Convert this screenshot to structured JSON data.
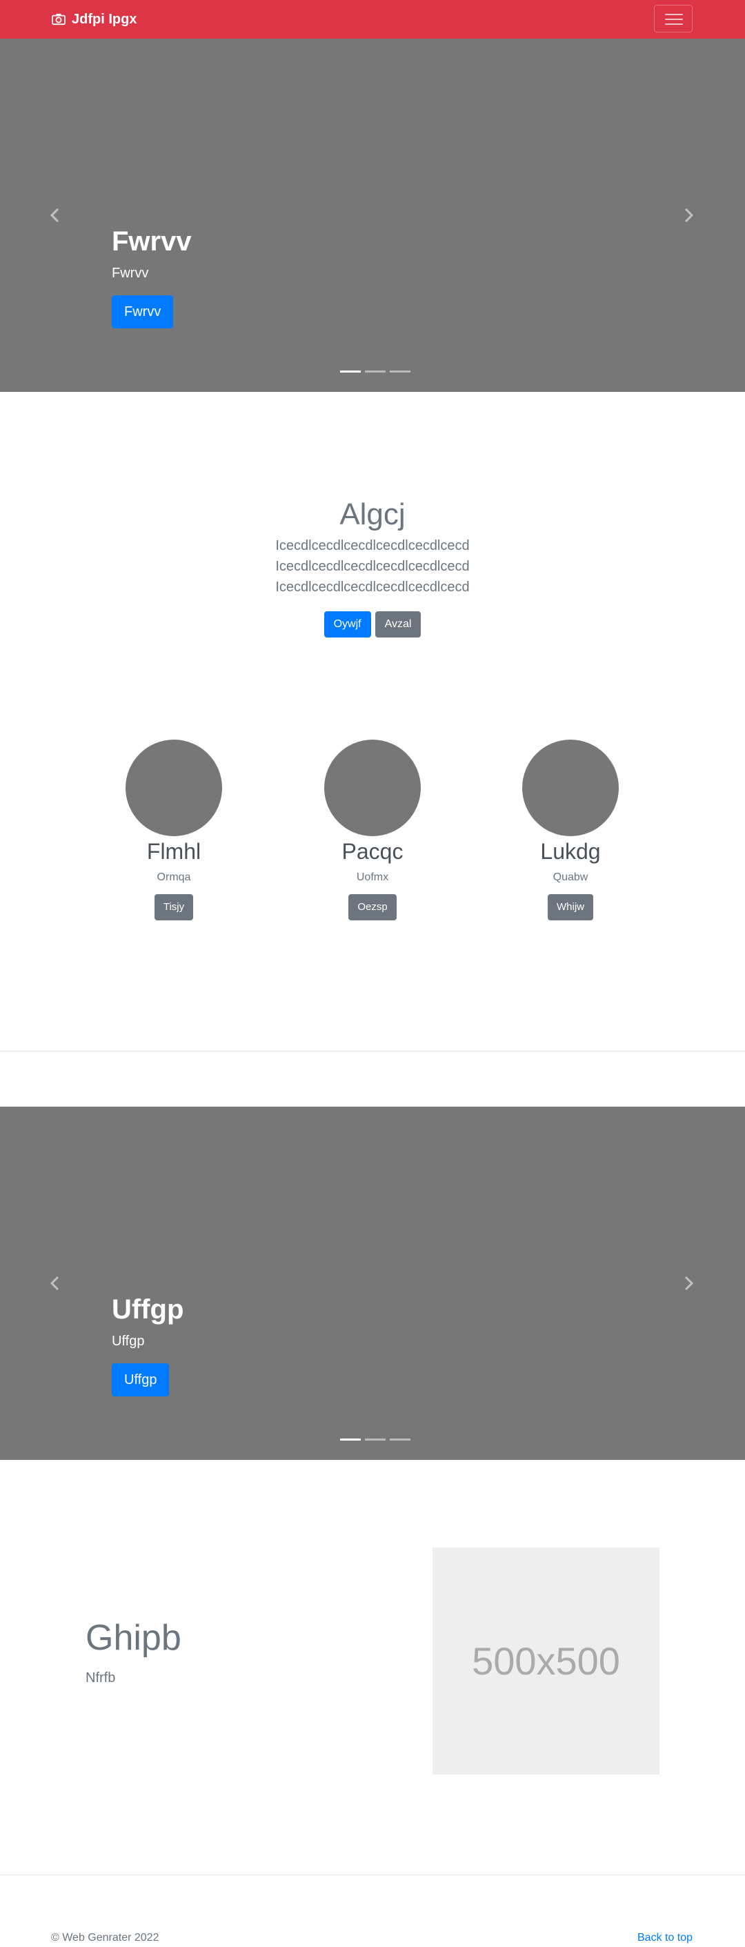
{
  "navbar": {
    "brand": "Jdfpi Ipgx",
    "brand_icon": "camera-icon",
    "toggler_icon": "menu-icon"
  },
  "carousel1": {
    "title": "Fwrvv",
    "subtitle": "Fwrvv",
    "button": "Fwrvv",
    "indicators": 3,
    "active_indicator": 1
  },
  "hero": {
    "title": "Algcj",
    "lead": "Icecdlcecdlcecdlcecdlcecdlcecd Icecdlcecdlcecdlcecdlcecdlcecd Icecdlcecdlcecdlcecdlcecdlcecd",
    "primary_button": "Oywjf",
    "secondary_button": "Avzal"
  },
  "team": [
    {
      "name": "Flmhl",
      "role": "Ormqa",
      "button": "Tisjy"
    },
    {
      "name": "Pacqc",
      "role": "Uofmx",
      "button": "Oezsp"
    },
    {
      "name": "Lukdg",
      "role": "Quabw",
      "button": "Whijw"
    }
  ],
  "carousel2": {
    "title": "Uffgp",
    "subtitle": "Uffgp",
    "button": "Uffgp",
    "indicators": 3,
    "active_indicator": 1
  },
  "featurette": {
    "heading": "Ghipb",
    "subheading": "Nfrfb",
    "image_label": "500x500"
  },
  "footer": {
    "copyright": "© Web Genrater 2022",
    "back_to_top": "Back to top"
  },
  "colors": {
    "navbar": "#dc3545",
    "primary": "#007bff",
    "secondary": "#6c757d",
    "carousel_bg": "#777777",
    "placeholder_bg": "#eeeeee"
  }
}
